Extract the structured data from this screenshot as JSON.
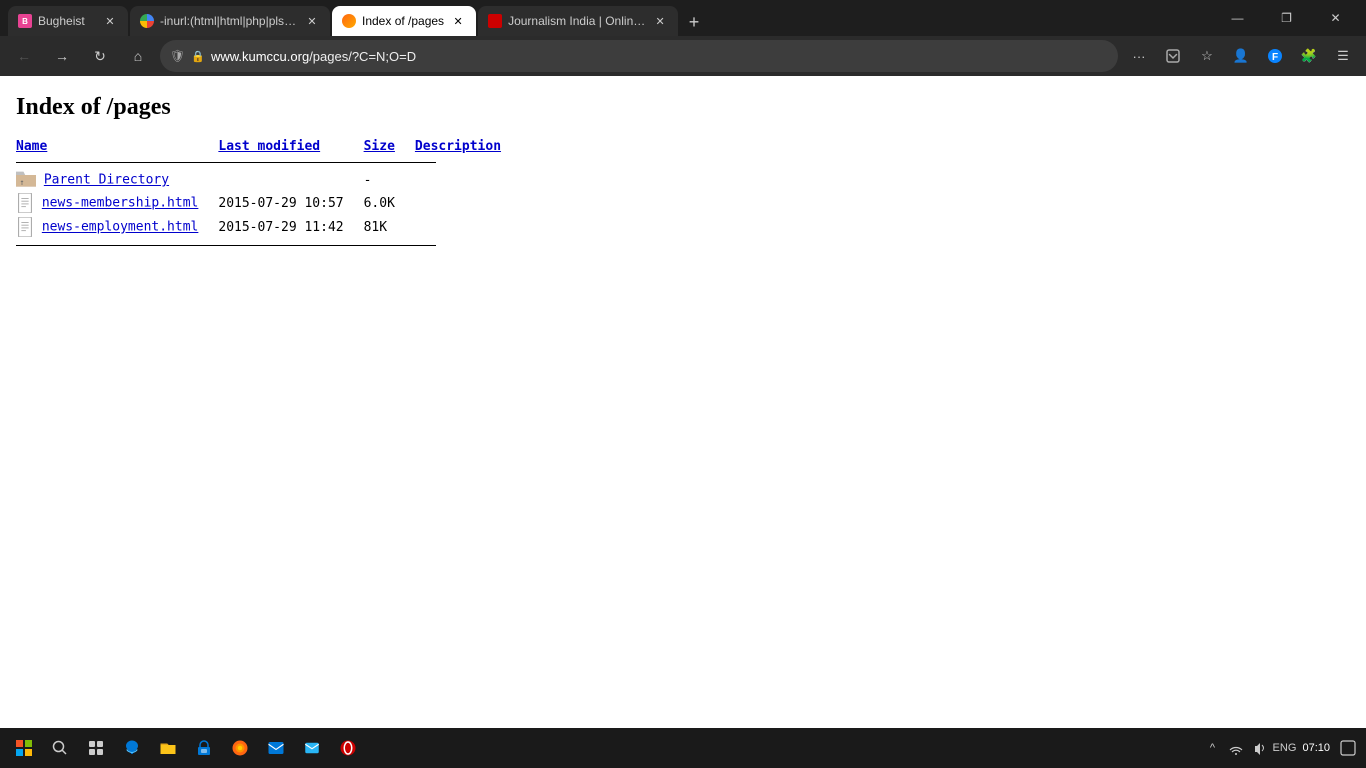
{
  "browser": {
    "tabs": [
      {
        "id": "tab1",
        "title": "Bugheist",
        "favicon": "bugheist",
        "active": false
      },
      {
        "id": "tab2",
        "title": "-inurl:(html|html|php|pls|txt) in...",
        "favicon": "google",
        "active": false
      },
      {
        "id": "tab3",
        "title": "Index of /pages",
        "favicon": "firefox",
        "active": true
      },
      {
        "id": "tab4",
        "title": "Journalism India | Online Journ...",
        "favicon": "journalism",
        "active": false
      }
    ],
    "url": {
      "prefix": "www.kumccu.org",
      "path": "/pages/?C=N;O=D"
    },
    "window_controls": {
      "minimize": "—",
      "maximize": "❐",
      "close": "✕"
    }
  },
  "page": {
    "title": "Index of /pages",
    "table": {
      "headers": {
        "name": "Name",
        "last_modified": "Last modified",
        "size": "Size",
        "description": "Description"
      },
      "rows": [
        {
          "type": "parent",
          "name": "Parent Directory",
          "modified": "",
          "size": "-",
          "description": ""
        },
        {
          "type": "file",
          "name": "news-membership.html",
          "modified": "2015-07-29 10:57",
          "size": "6.0K",
          "description": ""
        },
        {
          "type": "file",
          "name": "news-employment.html",
          "modified": "2015-07-29 11:42",
          "size": "81K",
          "description": ""
        }
      ]
    }
  },
  "taskbar": {
    "sys_icons": [
      "^",
      "💬",
      "🔊",
      "🌐"
    ],
    "language": "ENG",
    "time": "07:10",
    "date": ""
  }
}
